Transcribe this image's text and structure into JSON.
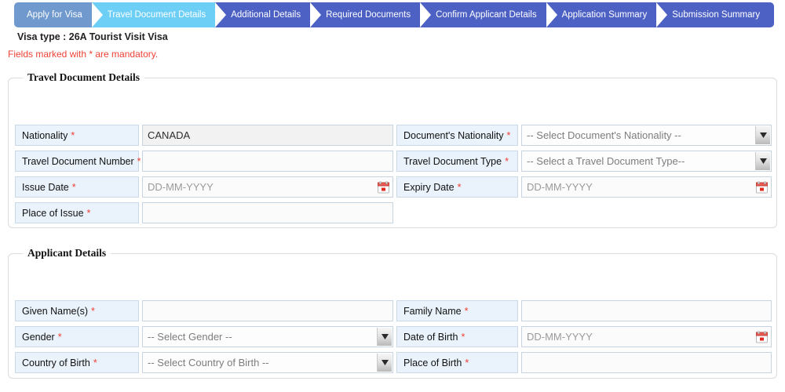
{
  "wizard": {
    "steps": [
      {
        "label": "Apply for Visa",
        "state": "completed",
        "color": "#7099ce"
      },
      {
        "label": "Travel Document Details",
        "state": "current",
        "color": "#6ecff6"
      },
      {
        "label": "Additional Details",
        "state": "upcoming",
        "color": "#4d61c4"
      },
      {
        "label": "Required Documents",
        "state": "upcoming",
        "color": "#4d61c4"
      },
      {
        "label": "Confirm Applicant Details",
        "state": "upcoming",
        "color": "#4d61c4"
      },
      {
        "label": "Application Summary",
        "state": "upcoming",
        "color": "#4d61c4"
      },
      {
        "label": "Submission Summary",
        "state": "upcoming",
        "color": "#4d61c4"
      }
    ]
  },
  "header": {
    "visa_type_label": "Visa type  : 26A Tourist Visit Visa",
    "mandatory_note": "Fields marked with * are mandatory.",
    "mandatory_color": "#ef4136"
  },
  "travel_document": {
    "legend": "Travel Document Details",
    "fields": {
      "nationality": {
        "label": "Nationality",
        "required": "*",
        "value": "CANADA",
        "placeholder": ""
      },
      "travel_document_number": {
        "label": "Travel Document Number",
        "required": "*",
        "value": "",
        "placeholder": ""
      },
      "issue_date": {
        "label": "Issue Date",
        "required": "*",
        "value": "",
        "placeholder": "DD-MM-YYYY",
        "icon": "calendar-icon"
      },
      "place_of_issue": {
        "label": "Place of Issue",
        "required": "*",
        "value": "",
        "placeholder": ""
      },
      "documents_nationality": {
        "label": "Document's Nationality",
        "required": "*",
        "selected": "-- Select Document's Nationality --",
        "icon": "chevron-down-icon"
      },
      "travel_document_type": {
        "label": "Travel Document Type",
        "required": "*",
        "selected": "-- Select a Travel Document Type--",
        "icon": "chevron-down-icon"
      },
      "expiry_date": {
        "label": "Expiry Date",
        "required": "*",
        "value": "",
        "placeholder": "DD-MM-YYYY",
        "icon": "calendar-icon"
      }
    }
  },
  "applicant": {
    "legend": "Applicant Details",
    "fields": {
      "given_names": {
        "label": "Given Name(s)",
        "required": "*",
        "value": "",
        "placeholder": ""
      },
      "gender": {
        "label": "Gender",
        "required": "*",
        "selected": "-- Select Gender --",
        "icon": "chevron-down-icon"
      },
      "country_of_birth": {
        "label": "Country of Birth",
        "required": "*",
        "selected": "-- Select Country of Birth --",
        "icon": "chevron-down-icon"
      },
      "family_name": {
        "label": "Family Name",
        "required": "*",
        "value": "",
        "placeholder": ""
      },
      "date_of_birth": {
        "label": "Date of Birth",
        "required": "*",
        "value": "",
        "placeholder": "DD-MM-YYYY",
        "icon": "calendar-icon"
      },
      "place_of_birth": {
        "label": "Place of Birth",
        "required": "*",
        "value": "",
        "placeholder": ""
      }
    }
  }
}
